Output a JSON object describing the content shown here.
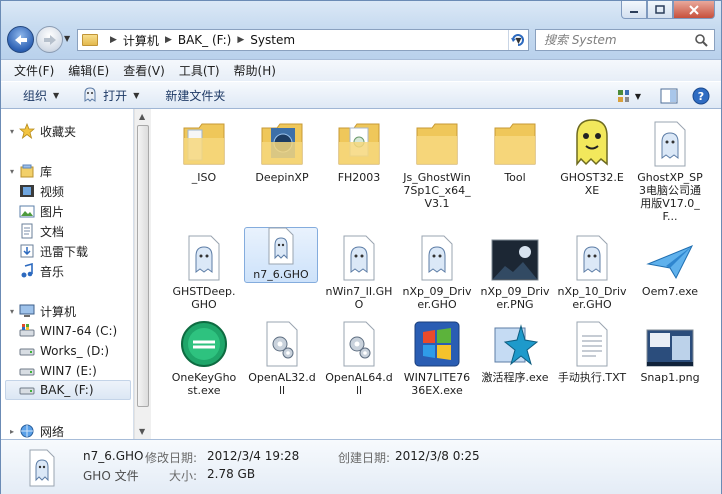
{
  "address": {
    "crumbs": [
      "计算机",
      "BAK_ (F:)",
      "System"
    ]
  },
  "search": {
    "placeholder": "搜索 System"
  },
  "menu": [
    "文件(F)",
    "编辑(E)",
    "查看(V)",
    "工具(T)",
    "帮助(H)"
  ],
  "toolbar": {
    "organize": "组织",
    "open": "打开",
    "new_folder": "新建文件夹"
  },
  "sidebar": {
    "favorites": "收藏夹",
    "libraries": "库",
    "lib_items": [
      "视频",
      "图片",
      "文档",
      "迅雷下载",
      "音乐"
    ],
    "computer": "计算机",
    "drives": [
      "WIN7-64 (C:)",
      "Works_ (D:)",
      "WIN7 (E:)",
      "BAK_ (F:)"
    ],
    "network": "网络"
  },
  "files": [
    {
      "name": "_ISO",
      "icon": "folder-icon"
    },
    {
      "name": "DeepinXP",
      "icon": "folder-icon"
    },
    {
      "name": "FH2003",
      "icon": "folder-icon"
    },
    {
      "name": "Js_GhostWin7Sp1C_x64_V3.1",
      "icon": "folder-icon"
    },
    {
      "name": "Tool",
      "icon": "folder-icon"
    },
    {
      "name": "GHOST32.EXE",
      "icon": "ghost-exe-icon"
    },
    {
      "name": "GhostXP_SP3电脑公司通用版V17.0_F...",
      "icon": "gho-file-icon"
    },
    {
      "name": "GHSTDeep.GHO",
      "icon": "gho-file-icon"
    },
    {
      "name": "n7_6.GHO",
      "icon": "gho-file-icon"
    },
    {
      "name": "nWin7_II.GHO",
      "icon": "gho-file-icon"
    },
    {
      "name": "nXp_09_Driver.GHO",
      "icon": "gho-file-icon"
    },
    {
      "name": "nXp_09_Driver.PNG",
      "icon": "png-image-icon"
    },
    {
      "name": "nXp_10_Driver.GHO",
      "icon": "gho-file-icon"
    },
    {
      "name": "Oem7.exe",
      "icon": "paper-plane-icon"
    },
    {
      "name": "OneKeyGhost.exe",
      "icon": "onekey-ghost-icon"
    },
    {
      "name": "OpenAL32.dll",
      "icon": "dll-file-icon"
    },
    {
      "name": "OpenAL64.dll",
      "icon": "dll-file-icon"
    },
    {
      "name": "WIN7LITE7636EX.exe",
      "icon": "windows-flag-icon"
    },
    {
      "name": "激活程序.exe",
      "icon": "activator-icon"
    },
    {
      "name": "手动执行.TXT",
      "icon": "text-file-icon"
    },
    {
      "name": "Snap1.png",
      "icon": "screenshot-image-icon"
    }
  ],
  "selected_file": "n7_6.GHO",
  "details": {
    "name": "n7_6.GHO",
    "type": "GHO 文件",
    "modified_label": "修改日期:",
    "modified_value": "2012/3/4 19:28",
    "created_label": "创建日期:",
    "created_value": "2012/3/8 0:25",
    "size_label": "大小:",
    "size_value": "2.78 GB"
  },
  "colors": {
    "selection": "#cde2fa",
    "chrome": "#c7dbf0",
    "border": "#6b8bb5"
  }
}
